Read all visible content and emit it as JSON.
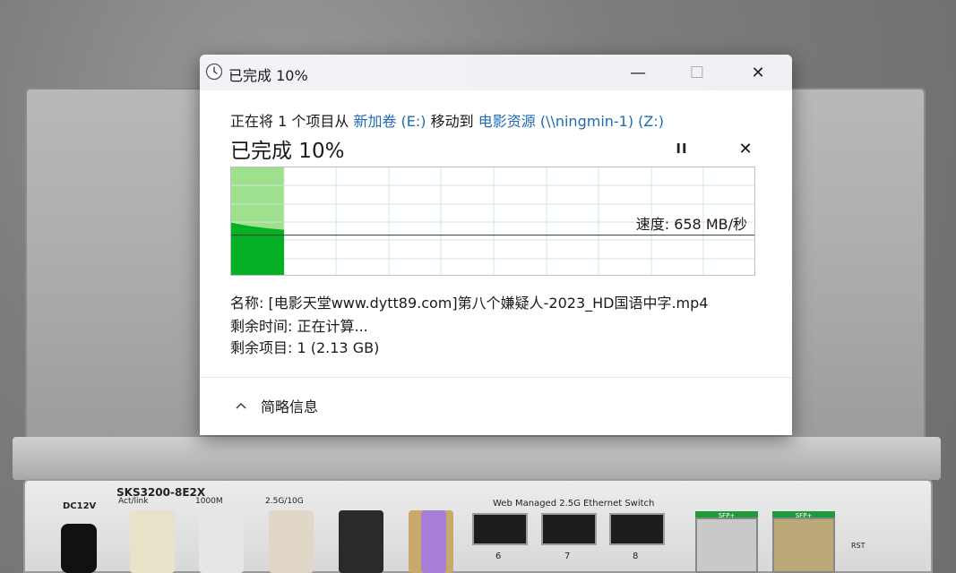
{
  "window": {
    "title": "已完成 10%",
    "minimize_glyph": "—",
    "maximize_glyph": "☐",
    "close_glyph": "✕"
  },
  "transfer": {
    "prefix": "正在将 1 个项目从",
    "source": "新加卷 (E:)",
    "middle": "移动到",
    "destination": "电影资源 (\\\\ningmin-1) (Z:)",
    "progress_title": "已完成 10%",
    "progress_percent": 10,
    "pause_glyph": "II",
    "cancel_glyph": "✕"
  },
  "speed_graph": {
    "speed_text": "速度: 658 MB/秒",
    "current_speed_fraction": 0.38,
    "colors": {
      "fill": "#06b025",
      "fill_light": "#9fe08f",
      "grid": "#cfe8cf",
      "line": "#3a3a3a"
    }
  },
  "details": {
    "name": "名称:  [电影天堂www.dytt89.com]第八个嫌疑人-2023_HD国语中字.mp4",
    "time_remaining": "剩余时间:  正在计算...",
    "items_remaining": "剩余项目:  1 (2.13 GB)"
  },
  "footer": {
    "toggle_label": "简略信息",
    "toggle_icon": "chevron-up-icon"
  },
  "device": {
    "model": "SKS3200-8E2X",
    "act_link": "Act/link",
    "led_1000": "1000M",
    "led_25": "2.5G/10G",
    "dc": "DC12V",
    "caption": "Web Managed 2.5G Ethernet Switch",
    "port_6": "6",
    "port_7": "7",
    "port_8": "8",
    "sfp_a": "SFP+",
    "sfp_b": "SFP+",
    "rst": "RST"
  }
}
